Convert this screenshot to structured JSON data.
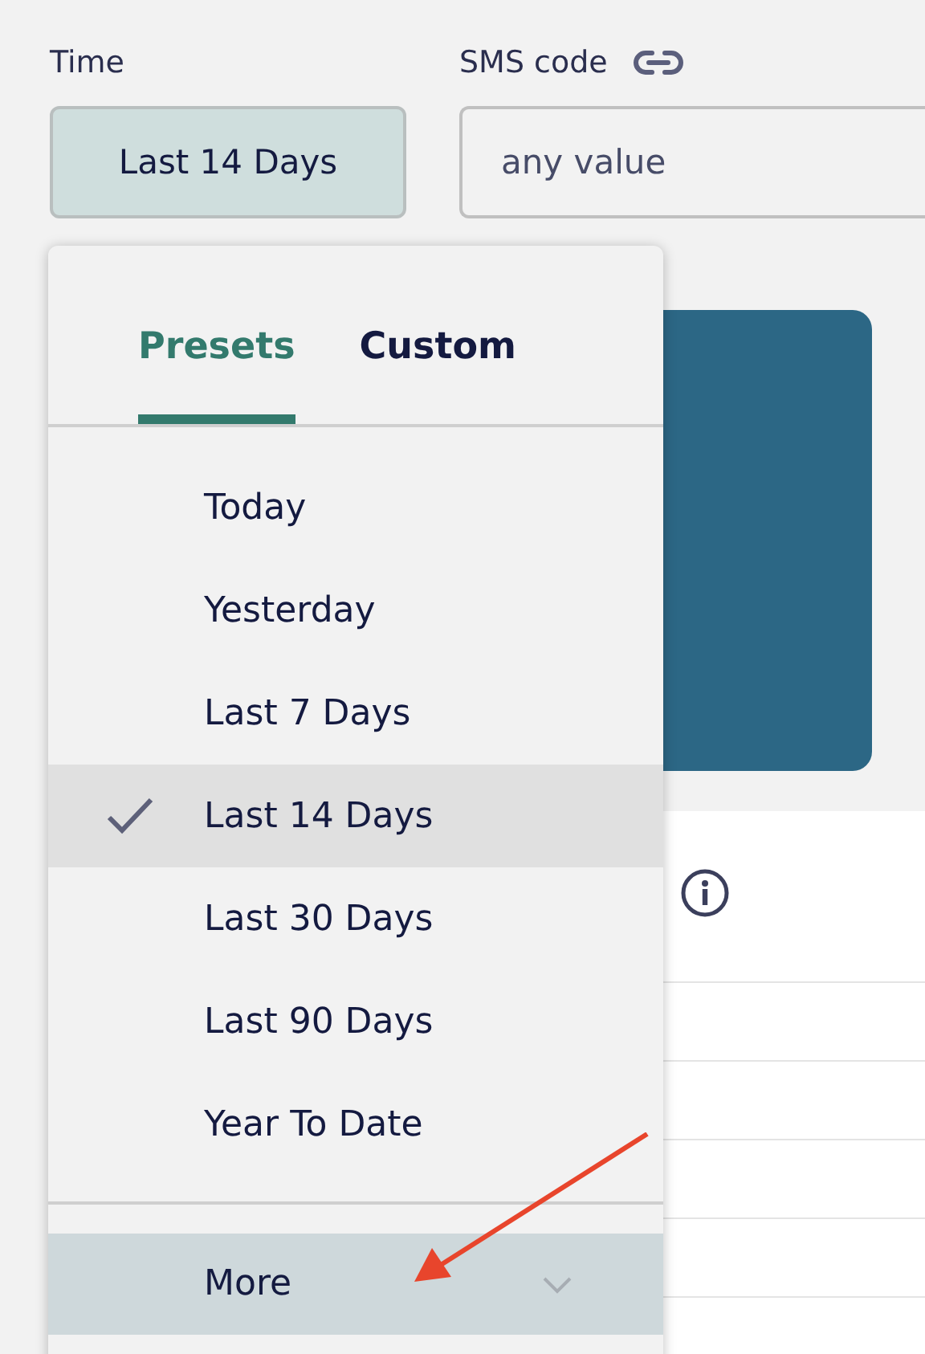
{
  "filters": [
    {
      "kind": "select",
      "label": "Time",
      "value": "Last 14 Days",
      "link": false
    },
    {
      "kind": "input",
      "label": "SMS code",
      "placeholder": "any value",
      "link": true
    }
  ],
  "dropdown": {
    "tabs": [
      {
        "label": "Presets",
        "selected": true
      },
      {
        "label": "Custom",
        "selected": false
      }
    ],
    "items": [
      {
        "label": "Today",
        "selected": false
      },
      {
        "label": "Yesterday",
        "selected": false
      },
      {
        "label": "Last 7 Days",
        "selected": false
      },
      {
        "label": "Last 14 Days",
        "selected": true
      },
      {
        "label": "Last 30 Days",
        "selected": false
      },
      {
        "label": "Last 90 Days",
        "selected": false
      },
      {
        "label": "Year To Date",
        "selected": false
      }
    ],
    "more": {
      "label": "More",
      "expanded": false
    }
  }
}
